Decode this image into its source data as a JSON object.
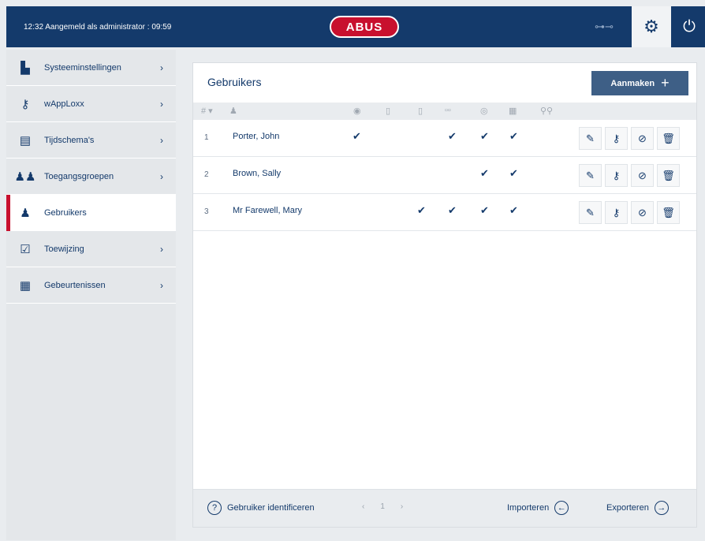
{
  "header": {
    "status": "12:32  Aangemeld als administrator : 09:59",
    "logo": "ABUS",
    "key_icon": "key-icon",
    "settings_icon": "gears-icon",
    "power_icon": "power-icon"
  },
  "sidebar": {
    "items": [
      {
        "label": "Systeeminstellingen",
        "icon": "settings-chart-icon",
        "chevron": "›"
      },
      {
        "label": "wAppLoxx",
        "icon": "key-icon",
        "chevron": "›"
      },
      {
        "label": "Tijdschema's",
        "icon": "calendar-clock-icon",
        "chevron": "›"
      },
      {
        "label": "Toegangsgroepen",
        "icon": "group-icon",
        "chevron": "›"
      },
      {
        "label": "Gebruikers",
        "icon": "user-icon",
        "chevron": ""
      },
      {
        "label": "Toewijzing",
        "icon": "checkbox-icon",
        "chevron": "›"
      },
      {
        "label": "Gebeurtenissen",
        "icon": "event-log-icon",
        "chevron": "›"
      }
    ]
  },
  "main": {
    "title": "Gebruikers",
    "add_button": "Aanmaken",
    "columns": {
      "number": "# ▾",
      "user": "♟",
      "c1": "◉",
      "c2": "▯",
      "c3": "▯",
      "c4": "▫▫",
      "c5": "◎",
      "c6": "▦",
      "c7": "⚲⚲"
    },
    "rows": [
      {
        "num": "1",
        "name": "Porter, John",
        "checks": [
          "✔",
          "",
          "",
          "✔",
          "✔",
          "✔"
        ]
      },
      {
        "num": "2",
        "name": "Brown, Sally",
        "checks": [
          "",
          "",
          "",
          "",
          "✔",
          "✔"
        ]
      },
      {
        "num": "3",
        "name": "Mr Farewell, Mary",
        "checks": [
          "",
          "",
          "✔",
          "✔",
          "✔",
          "✔"
        ]
      }
    ],
    "actions": {
      "edit": "✎",
      "assign": "⚷",
      "block": "⊘",
      "delete": "🗑"
    }
  },
  "footer": {
    "identify_label": "Gebruiker identificeren",
    "identify_icon": "?",
    "pager": [
      "‹",
      "1",
      "›"
    ],
    "import_label": "Importeren",
    "import_icon": "←",
    "export_label": "Exporteren",
    "export_icon": "→"
  }
}
